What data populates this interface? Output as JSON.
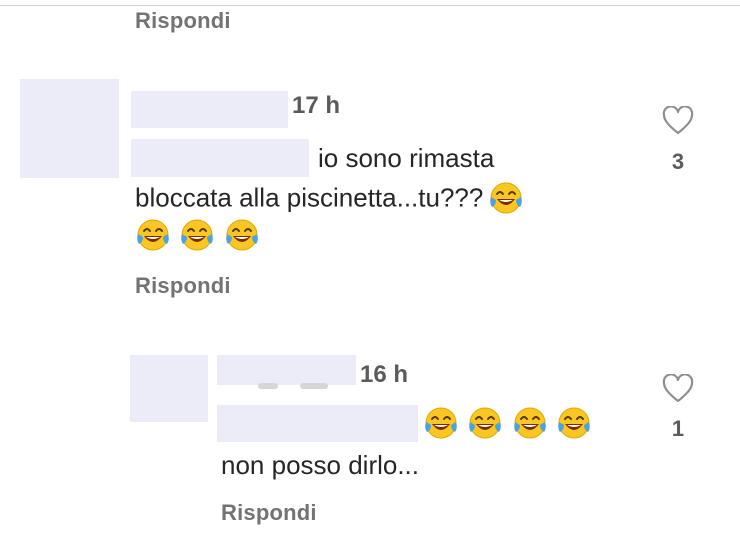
{
  "reply_label": "Rispondi",
  "comments": [
    {
      "time": "17 h",
      "text_line1": "io sono rimasta",
      "text_line2": "bloccata alla piscinetta...tu???",
      "likes": "3",
      "emoji_count": 4
    },
    {
      "time": "16 h",
      "text_line2": "non posso dirlo...",
      "likes": "1",
      "emoji_count": 4
    }
  ],
  "icons": {
    "like": "heart-outline-icon",
    "emoji": "face-with-tears-of-joy-icon"
  },
  "colors": {
    "redaction": "#ececf9",
    "secondary_text": "#737373",
    "emoji_face": "#f9c623",
    "emoji_tears": "#4aa3df"
  }
}
